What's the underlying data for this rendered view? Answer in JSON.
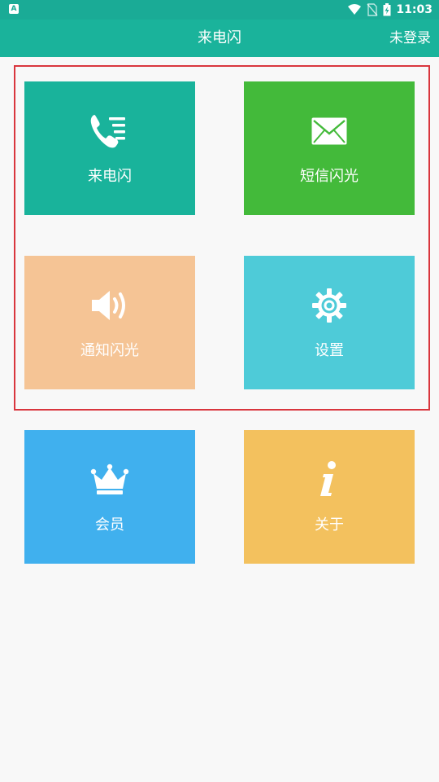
{
  "status_bar": {
    "left_icon": "A",
    "time": "11:03",
    "icons": [
      "wifi-icon",
      "no-sim-icon",
      "battery-charging-icon"
    ]
  },
  "appbar": {
    "title": "来电闪",
    "login_label": "未登录"
  },
  "tiles": [
    {
      "label": "来电闪",
      "icon": "phone-list-icon",
      "color": "#19b39b"
    },
    {
      "label": "短信闪光",
      "icon": "envelope-icon",
      "color": "#43ba3a"
    },
    {
      "label": "通知闪光",
      "icon": "speaker-icon",
      "color": "#f5c495"
    },
    {
      "label": "设置",
      "icon": "gear-icon",
      "color": "#4ecbd8"
    },
    {
      "label": "会员",
      "icon": "crown-icon",
      "color": "#40b0ee"
    },
    {
      "label": "关于",
      "icon": "info-icon",
      "color": "#f3c15e"
    }
  ],
  "colors": {
    "appbar": "#1ab39b",
    "highlight_border": "#d9363e",
    "background": "#f8f8f8"
  }
}
